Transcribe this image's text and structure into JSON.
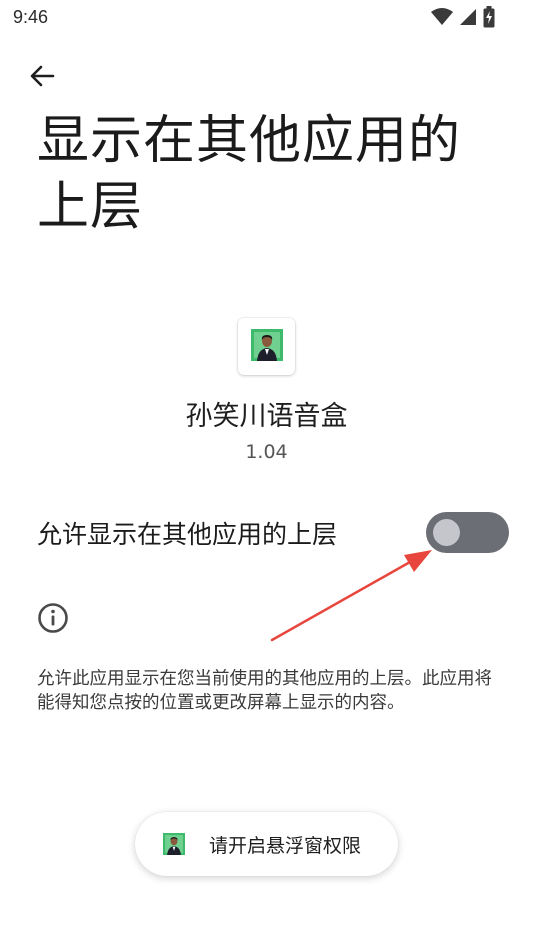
{
  "status_bar": {
    "time": "9:46",
    "icons": [
      "wifi-icon",
      "signal-icon",
      "battery-charging-icon"
    ]
  },
  "header": {
    "back_icon": "arrow-left-icon",
    "title": "显示在其他应用的上层"
  },
  "app": {
    "icon": "app-portrait-icon",
    "name": "孙笑川语音盒",
    "version": "1.04"
  },
  "setting": {
    "label": "允许显示在其他应用的上层",
    "toggle_state": "off"
  },
  "info": {
    "icon": "info-icon",
    "description": "允许此应用显示在您当前使用的其他应用的上层。此应用将能得知您点按的位置或更改屏幕上显示的内容。"
  },
  "overlay_button": {
    "icon": "app-portrait-icon",
    "label": "请开启悬浮窗权限"
  },
  "colors": {
    "background": "#ffffff",
    "toggle_track": "#6b6e75",
    "toggle_thumb": "#c5c6cb",
    "annotation_arrow": "#e8453c",
    "app_icon_bg": "#3dbb6b"
  }
}
